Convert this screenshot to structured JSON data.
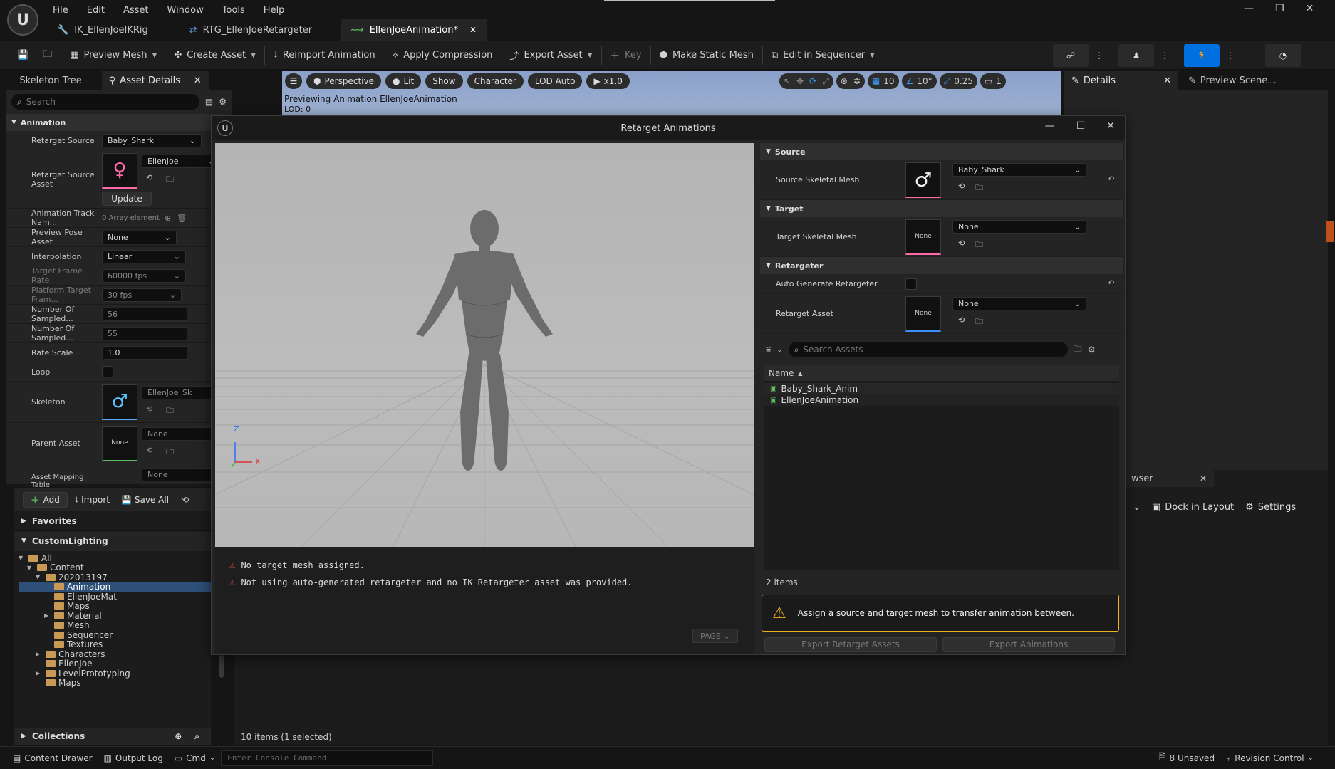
{
  "menu": [
    "File",
    "Edit",
    "Asset",
    "Window",
    "Tools",
    "Help"
  ],
  "doc_tabs": [
    {
      "label": "IK_EllenJoeIKRig"
    },
    {
      "label": "RTG_EllenJoeRetargeter"
    },
    {
      "label": "EllenJoeAnimation*"
    }
  ],
  "toolbar": {
    "preview_mesh": "Preview Mesh",
    "create_asset": "Create Asset",
    "reimport": "Reimport Animation",
    "apply_compression": "Apply Compression",
    "export_asset": "Export Asset",
    "key": "Key",
    "make_static_mesh": "Make Static Mesh",
    "edit_in_sequencer": "Edit in Sequencer"
  },
  "left_panel": {
    "tabs": [
      "Skeleton Tree",
      "Asset Details"
    ],
    "search_placeholder": "Search",
    "section": "Animation",
    "props": {
      "retarget_source_label": "Retarget Source",
      "retarget_source_value": "Baby_Shark",
      "retarget_source_asset_label": "Retarget Source Asset",
      "retarget_source_asset_value": "EllenJoe",
      "update": "Update",
      "track_names_label": "Animation Track Nam...",
      "track_names_value": "0 Array element",
      "preview_pose_label": "Preview Pose Asset",
      "preview_pose_value": "None",
      "interpolation_label": "Interpolation",
      "interpolation_value": "Linear",
      "target_frame_rate_label": "Target Frame Rate",
      "target_frame_rate_value": "60000 fps",
      "platform_frame_label": "Platform Target Fram...",
      "platform_frame_value": "30 fps",
      "num_sampled1_label": "Number Of Sampled...",
      "num_sampled1_value": "56",
      "num_sampled2_label": "Number Of Sampled...",
      "num_sampled2_value": "55",
      "rate_scale_label": "Rate Scale",
      "rate_scale_value": "1.0",
      "loop_label": "Loop",
      "skeleton_label": "Skeleton",
      "skeleton_value": "EllenJoe_Sk",
      "parent_asset_label": "Parent Asset",
      "parent_asset_value": "None",
      "none_thumb": "None",
      "asset_mapping_label": "Asset Mapping Table",
      "asset_mapping_value": "None"
    }
  },
  "content_browser": {
    "add": "Add",
    "import": "Import",
    "save_all": "Save All",
    "favorites": "Favorites",
    "custom_lighting": "CustomLighting",
    "tree": [
      {
        "label": "All",
        "depth": 0,
        "expanded": true
      },
      {
        "label": "Content",
        "depth": 1,
        "expanded": true
      },
      {
        "label": "202013197",
        "depth": 2,
        "expanded": true
      },
      {
        "label": "Animation",
        "depth": 3,
        "selected": true
      },
      {
        "label": "EllenJoeMat",
        "depth": 3
      },
      {
        "label": "Maps",
        "depth": 3
      },
      {
        "label": "Material",
        "depth": 3,
        "collapsed": true
      },
      {
        "label": "Mesh",
        "depth": 3
      },
      {
        "label": "Sequencer",
        "depth": 3
      },
      {
        "label": "Textures",
        "depth": 3
      },
      {
        "label": "Characters",
        "depth": 2,
        "collapsed": true
      },
      {
        "label": "EllenJoe",
        "depth": 2
      },
      {
        "label": "LevelPrototyping",
        "depth": 2,
        "collapsed": true
      },
      {
        "label": "Maps",
        "depth": 2
      }
    ],
    "collections": "Collections",
    "items_count": "10 items (1 selected)",
    "tab_partial": "wser",
    "dock_in_layout": "Dock in Layout",
    "settings": "Settings"
  },
  "viewport": {
    "perspective": "Perspective",
    "lit": "Lit",
    "show": "Show",
    "character": "Character",
    "lod": "LOD Auto",
    "speed": "x1.0",
    "grid": "10",
    "angle": "10°",
    "scale": "0.25",
    "cam": "1",
    "preview_text": "Previewing Animation EllenJoeAnimation",
    "lod_text": "LOD: 0"
  },
  "right_panel": {
    "details": "Details",
    "preview_scene": "Preview Scene..."
  },
  "dialog": {
    "title": "Retarget Animations",
    "source_section": "Source",
    "source_mesh_label": "Source Skeletal Mesh",
    "source_mesh_value": "Baby_Shark",
    "target_section": "Target",
    "target_mesh_label": "Target Skeletal Mesh",
    "target_mesh_value": "None",
    "target_thumb": "None",
    "retargeter_section": "Retargeter",
    "auto_gen_label": "Auto Generate Retargeter",
    "retarget_asset_label": "Retarget Asset",
    "retarget_asset_value": "None",
    "retarget_thumb": "None",
    "search_placeholder": "Search Assets",
    "name_col": "Name",
    "assets": [
      "Baby_Shark_Anim",
      "EllenJoeAnimation"
    ],
    "items_count": "2 items",
    "warning": "Assign a source and target mesh to transfer animation between.",
    "export_retarget": "Export Retarget Assets",
    "export_animations": "Export Animations",
    "messages": [
      "No target mesh assigned.",
      "Not using auto-generated retargeter and no IK Retargeter asset was provided."
    ],
    "page": "PAGE",
    "axis_x": "X",
    "axis_z": "Z"
  },
  "bottom": {
    "content_drawer": "Content Drawer",
    "output_log": "Output Log",
    "cmd": "Cmd",
    "console_placeholder": "Enter Console Command",
    "unsaved": "8 Unsaved",
    "revision": "Revision Control"
  },
  "colors": {
    "accent": "#0070e0",
    "warning": "#f0b020",
    "error": "#e04a4a",
    "selection": "#2d4f78"
  }
}
